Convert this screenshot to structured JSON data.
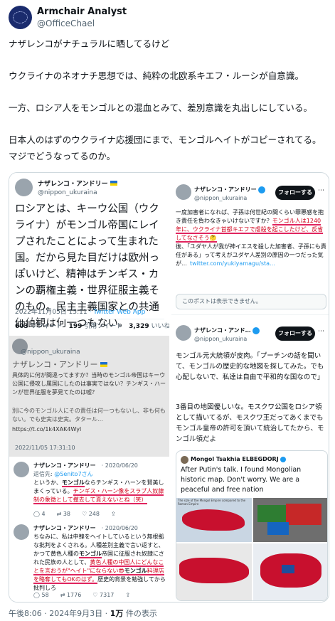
{
  "author": {
    "name": "Armchair Analyst",
    "handle": "@OfficeChael"
  },
  "tweet": {
    "text": "ナザレンコがナチュラルに晒してるけど\n\nウクライナのネオナチ思想では、純粋の北欧系キエフ・ルーシが自意識。\n\n一方、ロシア人をモンゴルとの混血とみて、差別意識を丸出しにしている。\n\n日本人のはずのウクライナ応援団にまで、モンゴルヘイトがコピーされてる。マジでどうなってるのか。"
  },
  "left_top": {
    "name": "ナザレンコ・アンドリー",
    "handle": "@nippon_ukuraina",
    "text": "ロシアとは、キーウ公国（ウクライナ）がモンゴル帝国にレイプされたことによって生まれた国。だから見た目だけは欧州っぽいけど、精神はチンギス・カンの覇権主義・世界征服主義そのもの。民主主義国家との共通価値観は何一つもない。",
    "date": "2022年11月05日 15:11",
    "via": "· Twitter Web App",
    "stats": {
      "retweets": "603",
      "retweets_label": "リツイート",
      "quotes": "199",
      "quotes_label": "引用ツイート",
      "likes": "3,329",
      "likes_label": "いいね"
    }
  },
  "left_mid": {
    "name": "ナザレンコ・アンドリー",
    "handle": "@nippon_ukuraina",
    "text1": "具体的に何が間違ってますか？当時のモンゴル帝国はキーウ公国に侵攻し属国にしたのは事実ではない？チンギス・ハーンが世界征服を夢見てたのは嘘？",
    "text2": "別に今のモンゴル人にその責任は何一つもないし、非も何もない。でも史実は史実。タタール…",
    "link": "https://t.co/1k4XAK4Wyl",
    "date": "2022/11/05 17:31:10"
  },
  "left_reply1": {
    "name": "ナザレンコ・アンドリー",
    "date": "· 2020/06/20",
    "reply_to_label": "返信先: ",
    "reply_to": "@Senito7さん",
    "text_a": "というか、",
    "text_b": "モンゴル",
    "text_c": "ならチンギス・ハーンを賛美しまくっている。",
    "text_d": "チンギス・ハーン像をスラブ人奴隷制の象徴として撤去して貰えないとね（笑）",
    "stats": [
      "4",
      "38",
      "248"
    ]
  },
  "left_reply2": {
    "name": "ナザレンコ・アンドリー",
    "date": "· 2020/06/20",
    "text_a": "ちなみに、私は中韓をヘイトしているという無根拠な批判をよくされる。人種差別主義で言い返すと、かつて黄色人種の",
    "text_b": "モンゴル",
    "text_c": "帝国に征服され奴隷にされた民族の人として、",
    "text_d": "黄色人種の中国人にどんなことを言おうが\"ヘイト\"にならない😎",
    "text_e": "モンゴル",
    "text_f": "料理店を略奪してもOKのはず。",
    "text_g": "歴史的背景を勉強してから批判しろ",
    "stats": [
      "58",
      "1776",
      "7317"
    ]
  },
  "right_top": {
    "name": "ナザレンコ・アンドリー",
    "handle": "@nippon_ukuraina",
    "follow": "フォローする",
    "text_a": "一度加害者になれば、子孫は何世紀の間くらい罪悪感を抱き責任を負わなきゃいけないですか？",
    "text_b": "モンゴル人は1240年に、ウクライナ首都キエフで虐殺を起こしたけど、反省してなさそう🤔",
    "text_c": "後、「ユダヤ人が我が神イエスを殺した加害者、子孫にも責任がある」って考えがユダヤ人差別の原因の一つだった気が…",
    "link": "twitter.com/yukiyamagu/sta…",
    "unavailable": "このポストは表示できません。"
  },
  "right_bottom": {
    "name": "ナザレンコ・アンド…",
    "handle": "@nippon_ukuraina",
    "follow": "フォローする",
    "text1": "モンゴル元大統領が皮肉。「プーチンの話を聞いて、モンゴルの歴史的な地図を探してみた。でも心配しないで、私達は自由で平和的な国なので」",
    "text2": "3番目の地図優しいな。モスクワ公国をロシア領として描いてるが、モスクワ王だってあくまでもモンゴル皇帝の許可を頂いて統治してたから、モンゴル領だよ",
    "quote_name": "Mongol Tsakhia ELBEGDORJ",
    "quote_text": "After Putin's talk. I found Mongolian historic map. Don't worry. We are a peaceful and free nation",
    "map_caption": "The size of the Mongol Empire compared to the Roman Empire"
  },
  "footer": {
    "time": "午後8:06 · 2024年9月3日 · ",
    "views": "1万",
    "views_label": " 件の表示"
  },
  "colors": {
    "accent": "#1d9bf0",
    "highlight_red": "#d0021b",
    "underline": "#e0245e"
  }
}
